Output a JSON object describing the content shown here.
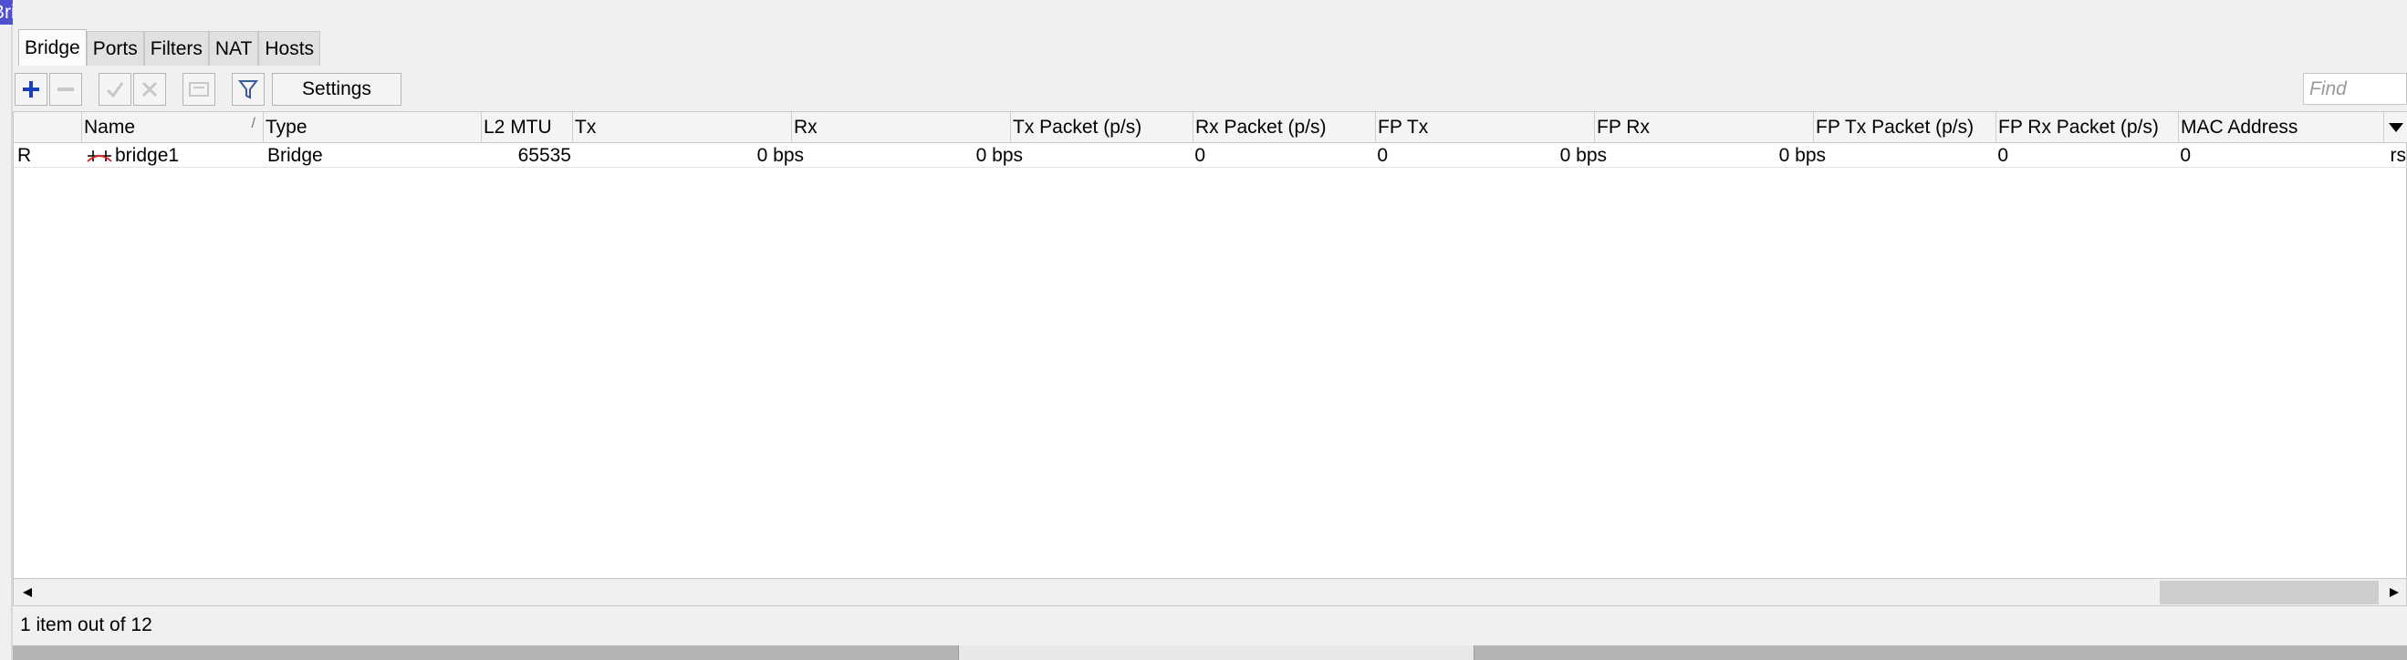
{
  "window": {
    "title": "Bridge",
    "maximize_icon": "maximize-icon",
    "close_icon": "close-icon"
  },
  "tabs": [
    {
      "label": "Bridge",
      "active": true
    },
    {
      "label": "Ports",
      "active": false
    },
    {
      "label": "Filters",
      "active": false
    },
    {
      "label": "NAT",
      "active": false
    },
    {
      "label": "Hosts",
      "active": false
    }
  ],
  "toolbar": {
    "add_icon": "plus-icon",
    "remove_icon": "minus-icon",
    "enable_icon": "check-icon",
    "disable_icon": "x-icon",
    "comment_icon": "comment-icon",
    "filter_icon": "filter-icon",
    "settings_label": "Settings",
    "find_placeholder": "Find",
    "accent_color": "#1a3fb8"
  },
  "table": {
    "columns": [
      "",
      "Name",
      "Type",
      "L2 MTU",
      "Tx",
      "Rx",
      "Tx Packet (p/s)",
      "Rx Packet (p/s)",
      "FP Tx",
      "FP Rx",
      "FP Tx Packet (p/s)",
      "FP Rx Packet (p/s)",
      "MAC Address"
    ],
    "sort_column": "Name",
    "rows": [
      {
        "flag": "R",
        "icon": "bridge-icon",
        "name": "bridge1",
        "type": "Bridge",
        "l2mtu": "65535",
        "tx": "0 bps",
        "rx": "0 bps",
        "tx_packet": "0",
        "rx_packet": "0",
        "fp_tx": "0 bps",
        "fp_rx": "0 bps",
        "fp_tx_packet": "0",
        "fp_rx_packet": "0",
        "mac_address": "rs"
      }
    ]
  },
  "status": {
    "text": "1 item out of 12"
  }
}
